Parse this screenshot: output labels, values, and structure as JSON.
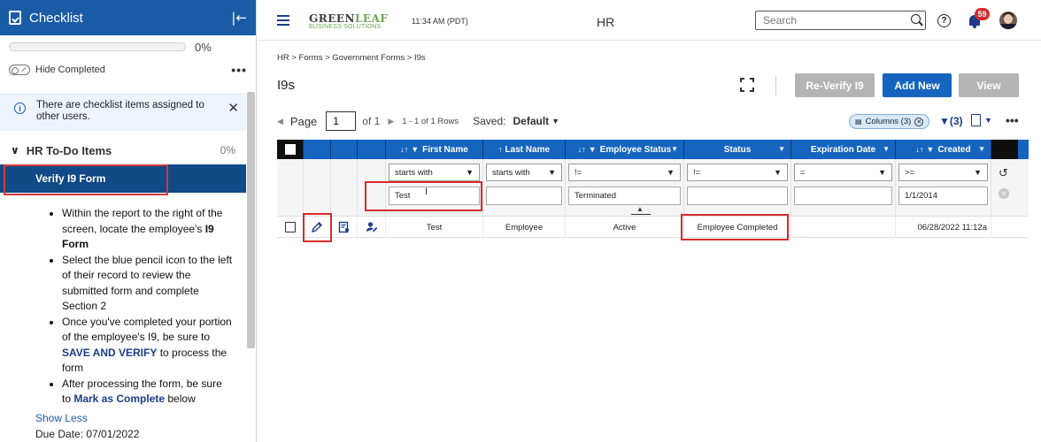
{
  "sidebar": {
    "title": "Checklist",
    "progress_value": 0,
    "progress_pct": "0%",
    "hide_completed_label": "Hide Completed",
    "info_banner_text": "There are checklist items assigned to other users.",
    "section_title": "HR To-Do Items",
    "section_pct": "0%",
    "active_item_label": "Verify I9 Form",
    "instructions": [
      {
        "pre": "Within the report to the right of the screen, locate the employee's ",
        "em": "I9 Form",
        "post": ""
      },
      {
        "pre": "Select the blue pencil icon to the left of their record to review the submitted form and complete Section 2",
        "em": "",
        "post": ""
      },
      {
        "pre": "Once you've completed your portion of the employee's I9, be sure to ",
        "em": "SAVE AND VERIFY",
        "post": " to process the form"
      },
      {
        "pre": "After processing the form, be sure to ",
        "em": "Mark as Complete",
        "post": " below"
      }
    ],
    "show_less_label": "Show Less",
    "due_date": "Due Date: 07/01/2022"
  },
  "topbar": {
    "logo_line1_a": "GREEN",
    "logo_line1_b": "LEAF",
    "logo_line2": "BUSINESS SOLUTIONS",
    "time": "11:34 AM (PDT)",
    "module_title": "HR",
    "search_placeholder": "Search",
    "help_glyph": "?",
    "notification_count": "59"
  },
  "main": {
    "breadcrumb": "HR > Forms > Government Forms > I9s",
    "page_title": "I9s",
    "buttons": {
      "reverify": "Re-Verify I9",
      "add_new": "Add New",
      "view": "View"
    },
    "pager": {
      "page_label": "Page",
      "page_value": "1",
      "of_label": "of 1",
      "rows_label": "1 - 1 of 1 Rows",
      "saved_label": "Saved:",
      "saved_value": "Default"
    },
    "columns_chip": "Columns (3)",
    "filter_count": "(3)",
    "grid": {
      "columns": [
        {
          "label": "First Name",
          "sort": "↓↑",
          "filter": true
        },
        {
          "label": "Last Name",
          "sort": "↑",
          "filter": false
        },
        {
          "label": "Employee Status",
          "sort": "↓↑",
          "filter": true
        },
        {
          "label": "Status",
          "sort": "",
          "filter": false
        },
        {
          "label": "Expiration Date",
          "sort": "",
          "filter": false
        },
        {
          "label": "Created",
          "sort": "↓↑",
          "filter": true
        }
      ],
      "filters": {
        "first_name": {
          "op": "starts with",
          "value": "Test"
        },
        "last_name": {
          "op": "starts with",
          "value": ""
        },
        "employee_status": {
          "op": "!=",
          "value": "Terminated"
        },
        "status": {
          "op": "!=",
          "value": ""
        },
        "expiration_date": {
          "op": "=",
          "value": ""
        },
        "created": {
          "op": ">=",
          "value": "1/1/2014"
        }
      },
      "rows": [
        {
          "first_name": "Test",
          "last_name": "Employee",
          "employee_status": "Active",
          "status": "Employee Completed",
          "expiration_date": "",
          "created": "06/28/2022 11:12a"
        }
      ]
    }
  }
}
